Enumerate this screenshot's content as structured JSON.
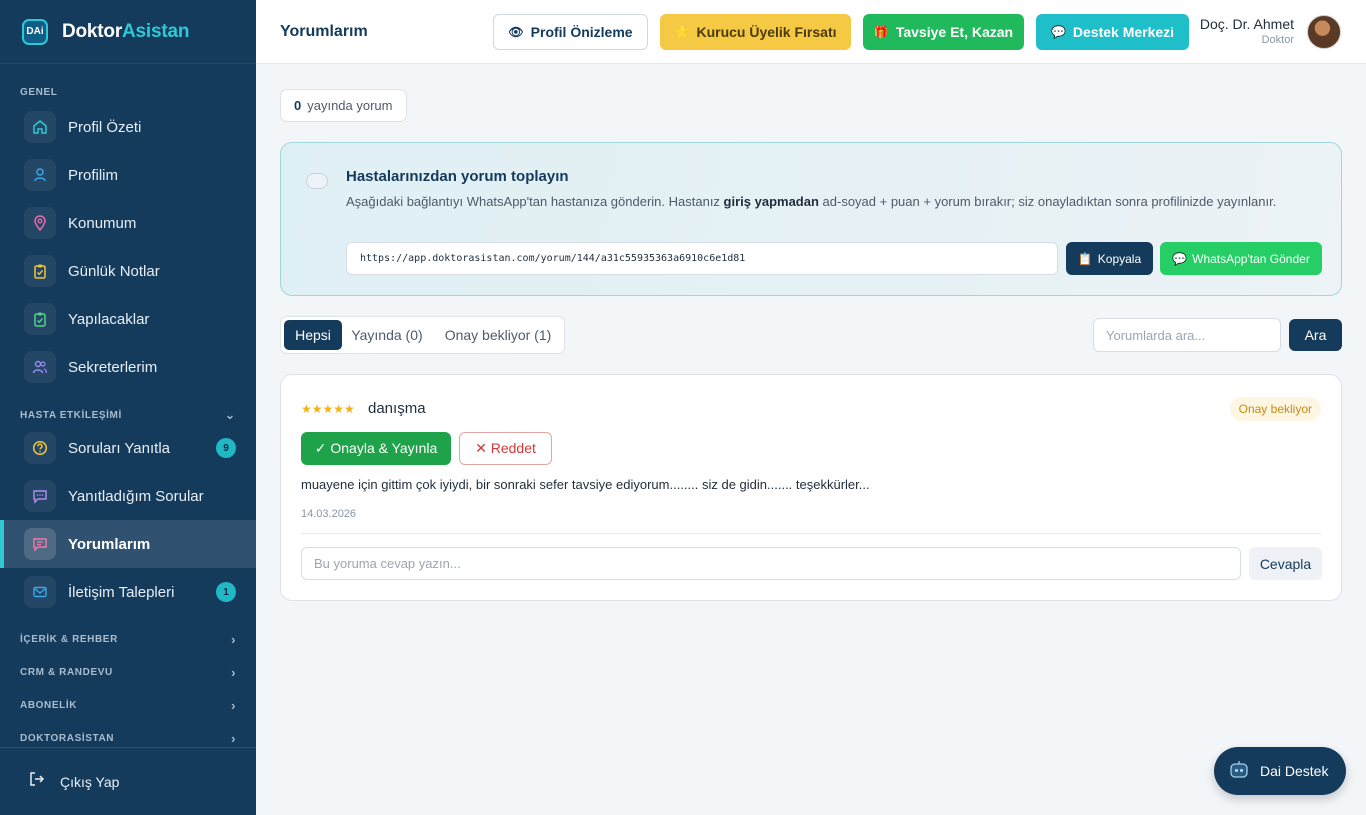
{
  "brand": {
    "logo": "DAi",
    "name_part1": "Doktor",
    "name_part2": "Asistan"
  },
  "sidebar": {
    "sections": {
      "genel": "GENEL",
      "hasta": "HASTA ETKİLEŞİMİ",
      "icerik": "İÇERİK & REHBER",
      "crm": "CRM & RANDEVU",
      "abonelik": "ABONELİK",
      "doktorasistan": "DOKTORASİSTAN"
    },
    "items": [
      {
        "label": "Profil Özeti",
        "icon": "home-icon"
      },
      {
        "label": "Profilim",
        "icon": "user-icon"
      },
      {
        "label": "Konumum",
        "icon": "location-pin-icon"
      },
      {
        "label": "Günlük Notlar",
        "icon": "clipboard-check-icon"
      },
      {
        "label": "Yapılacaklar",
        "icon": "clipboard-list-icon"
      },
      {
        "label": "Sekreterlerim",
        "icon": "users-icon"
      },
      {
        "label": "Soruları Yanıtla",
        "icon": "question-circle-icon",
        "badge": "9"
      },
      {
        "label": "Yanıtladığım Sorular",
        "icon": "chat-icon"
      },
      {
        "label": "Yorumlarım",
        "icon": "comment-icon",
        "active": true
      },
      {
        "label": "İletişim Talepleri",
        "icon": "mail-icon",
        "badge": "1"
      }
    ],
    "logout": "Çıkış Yap"
  },
  "topbar": {
    "title": "Yorumlarım",
    "preview": "Profil Önizleme",
    "founder": "Kurucu Üyelik Fırsatı",
    "refer": "Tavsiye Et, Kazan",
    "support": "Destek Merkezi",
    "user_name": "Doç. Dr. Ahmet",
    "user_role": "Doktor"
  },
  "counter": {
    "value": "0",
    "label": "yayında yorum"
  },
  "promo": {
    "title": "Hastalarınızdan yorum toplayın",
    "text_before": "Aşağıdaki bağlantıyı WhatsApp'tan hastanıza gönderin. Hastanız ",
    "text_bold": "giriş yapmadan",
    "text_after": " ad-soyad + puan + yorum bırakır; siz onayladıktan sonra profilinizde yayınlanır.",
    "url": "https://app.doktorasistan.com/yorum/144/a31c55935363a6910c6e1d81",
    "copy": "Kopyala",
    "whatsapp": "WhatsApp'tan Gönder"
  },
  "filters": {
    "tabs": [
      "Hepsi",
      "Yayında (0)",
      "Onay bekliyor (1)"
    ],
    "active_tab": "Hepsi",
    "search_placeholder": "Yorumlarda ara...",
    "search_button": "Ara"
  },
  "review": {
    "stars": "★★★★★",
    "rating": 5,
    "title": "danışma",
    "status": "Onay bekliyor",
    "approve": "✓ Onayla & Yayınla",
    "reject": "✕ Reddet",
    "text": "muayene için gittim çok iyiydi, bir sonraki sefer tavsiye ediyorum........ siz de gidin....... teşekkürler...",
    "date": "14.03.2026",
    "reply_placeholder": "Bu yoruma cevap yazın...",
    "reply_button": "Cevapla"
  },
  "support_chat": {
    "label": "Dai Destek"
  },
  "colors": {
    "sidebar": "#143a5c",
    "accent": "#2ec9d4",
    "approve": "#1fa34a",
    "reject": "#d23a3a"
  }
}
